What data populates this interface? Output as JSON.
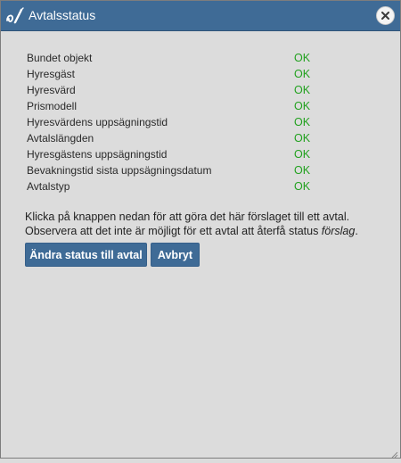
{
  "dialog": {
    "title": "Avtalsstatus",
    "app_icon": "contract-signature-icon",
    "close_icon": "close-icon"
  },
  "status_items": [
    {
      "label": "Bundet objekt",
      "status": "OK"
    },
    {
      "label": "Hyresgäst",
      "status": "OK"
    },
    {
      "label": "Hyresvärd",
      "status": "OK"
    },
    {
      "label": "Prismodell",
      "status": "OK"
    },
    {
      "label": "Hyresvärdens uppsägningstid",
      "status": "OK"
    },
    {
      "label": "Avtalslängden",
      "status": "OK"
    },
    {
      "label": "Hyresgästens uppsägningstid",
      "status": "OK"
    },
    {
      "label": "Bevakningstid sista uppsägningsdatum",
      "status": "OK"
    },
    {
      "label": "Avtalstyp",
      "status": "OK"
    }
  ],
  "info": {
    "line1": "Klicka på knappen nedan för att göra det här förslaget till ett avtal.",
    "line2_prefix": "Observera att det inte är möjligt för ett avtal att återfå status ",
    "line2_emphasis": "förslag",
    "line2_suffix": "."
  },
  "buttons": {
    "change_status": "Ändra status till avtal",
    "cancel": "Avbryt"
  },
  "colors": {
    "titlebar": "#3f6b96",
    "button": "#3f6b96",
    "background": "#dcdcdc",
    "ok_status": "#22a11f"
  }
}
